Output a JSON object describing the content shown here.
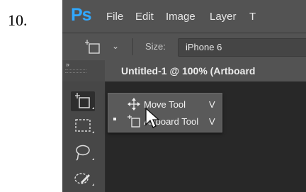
{
  "step_number": "10.",
  "app": {
    "logo": "Ps",
    "menu": [
      "File",
      "Edit",
      "Image",
      "Layer",
      "T"
    ]
  },
  "options_bar": {
    "tool_icon": "artboard-tool-icon",
    "size_label": "Size:",
    "size_value": "iPhone 6"
  },
  "toolbox": {
    "collapse_label": "»",
    "tools": [
      "artboard-tool-icon",
      "rectangular-marquee-icon",
      "lasso-icon",
      "quick-selection-icon"
    ],
    "active_tool": "artboard-tool-icon"
  },
  "document": {
    "tab_title": "Untitled-1 @ 100% (Artboard"
  },
  "flyout": {
    "items": [
      {
        "label": "Move Tool",
        "shortcut": "V",
        "icon": "move-icon",
        "selected": false
      },
      {
        "label": "Artboard Tool",
        "shortcut": "V",
        "icon": "artboard-icon",
        "selected": true
      }
    ]
  },
  "colors": {
    "menubar": "#535353",
    "panel": "#474747",
    "canvas": "#282828",
    "ps_logo": "#31a8ff"
  }
}
